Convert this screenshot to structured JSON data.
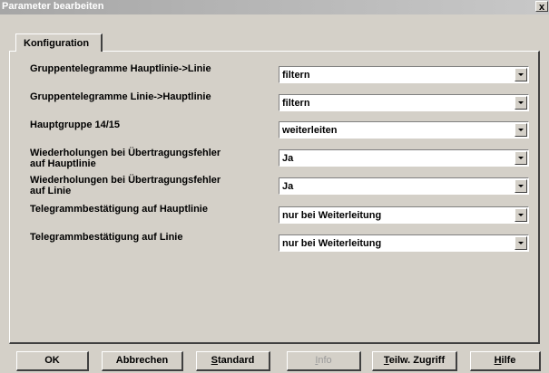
{
  "window": {
    "title": "Parameter bearbeiten",
    "close_label": "x"
  },
  "tab": {
    "label": "Konfiguration"
  },
  "params": [
    {
      "label_line1": "Gruppentelegramme Hauptlinie->Linie",
      "label_line2": "",
      "value": "filtern"
    },
    {
      "label_line1": "Gruppentelegramme Linie->Hauptlinie",
      "label_line2": "",
      "value": "filtern"
    },
    {
      "label_line1": "Hauptgruppe 14/15",
      "label_line2": "",
      "value": "weiterleiten"
    },
    {
      "label_line1": "Wiederholungen bei Übertragungsfehler",
      "label_line2": "auf Hauptlinie",
      "value": "Ja"
    },
    {
      "label_line1": "Wiederholungen bei Übertragungsfehler",
      "label_line2": "auf Linie",
      "value": "Ja"
    },
    {
      "label_line1": "Telegrammbestätigung auf Hauptlinie",
      "label_line2": "",
      "value": "nur bei Weiterleitung"
    },
    {
      "label_line1": "Telegrammbestätigung auf Linie",
      "label_line2": "",
      "value": "nur bei Weiterleitung"
    }
  ],
  "buttons": {
    "ok": "OK",
    "abbrechen": "Abbrechen",
    "standard_first": "S",
    "standard_rest": "tandard",
    "info_first": "I",
    "info_rest": "nfo",
    "teilw_first": "T",
    "teilw_rest": "eilw. Zugriff",
    "hilfe_first": "H",
    "hilfe_rest": "ilfe"
  }
}
